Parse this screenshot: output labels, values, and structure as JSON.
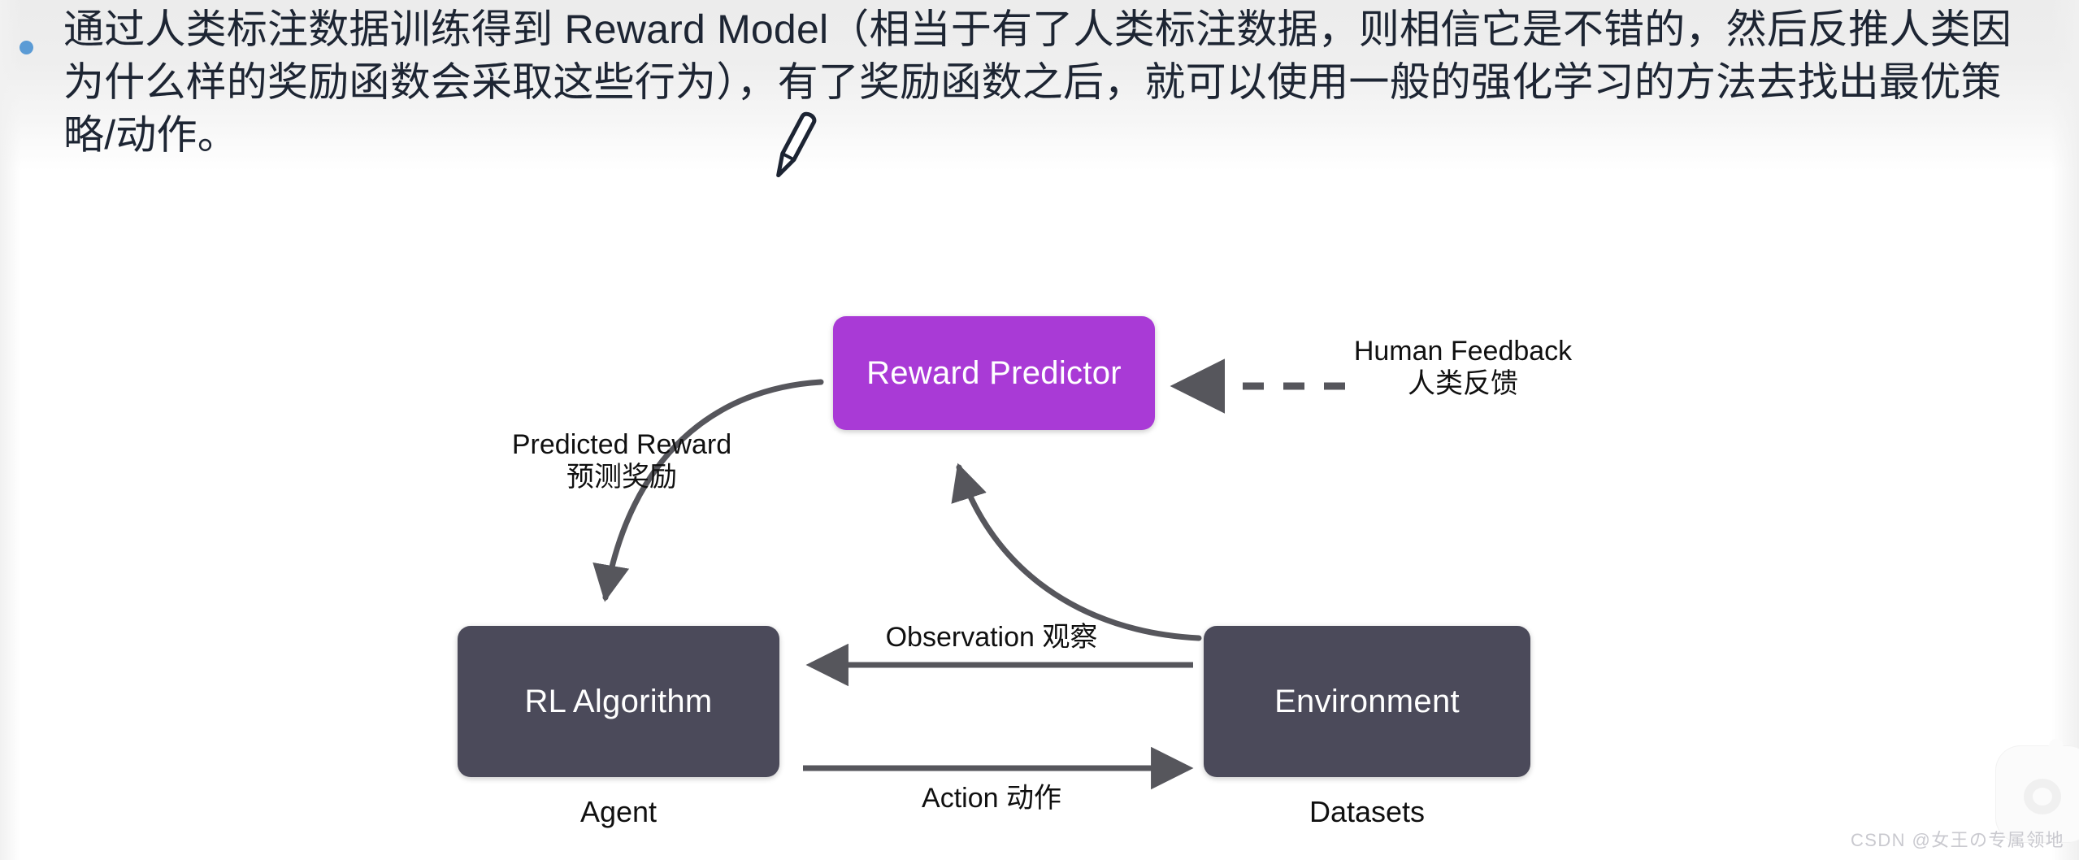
{
  "slide": {
    "bullet": {
      "marker": "bullet-dot",
      "text": "通过人类标注数据训练得到 Reward Model（相当于有了人类标注数据，则相信它是不错的，然后反推人类因为什么样的奖励函数会采取这些行为），有了奖励函数之后，就可以使用一般的强化学习的方法去找出最优策略/动作。"
    },
    "cursor_icon": "pen-cursor"
  },
  "diagram": {
    "type": "flow-diagram",
    "nodes": [
      {
        "id": "reward_predictor",
        "label": "Reward Predictor",
        "color": "#a93ad6",
        "caption": ""
      },
      {
        "id": "rl_algorithm",
        "label": "RL Algorithm",
        "color": "#4b4a5a",
        "caption": "Agent"
      },
      {
        "id": "environment",
        "label": "Environment",
        "color": "#4b4a5a",
        "caption": "Datasets"
      }
    ],
    "captions": {
      "agent": "Agent",
      "datasets": "Datasets"
    },
    "edges": [
      {
        "id": "predicted_reward",
        "from": "reward_predictor",
        "to": "rl_algorithm",
        "style": "curved-solid",
        "label_en": "Predicted Reward",
        "label_zh": "预测奖励"
      },
      {
        "id": "human_feedback",
        "from": "human",
        "to": "reward_predictor",
        "style": "dashed",
        "label_en": "Human Feedback",
        "label_zh": "人类反馈"
      },
      {
        "id": "observation",
        "from": "environment",
        "to": "rl_algorithm",
        "style": "straight-solid",
        "label_en": "Observation 观察",
        "label_zh": ""
      },
      {
        "id": "action",
        "from": "rl_algorithm",
        "to": "environment",
        "style": "straight-solid",
        "label_en": "Action 动作",
        "label_zh": ""
      },
      {
        "id": "observation_to_predictor",
        "from": "environment",
        "to": "reward_predictor",
        "style": "curved-solid",
        "label_en": "",
        "label_zh": ""
      }
    ],
    "colors": {
      "accent_purple": "#a93ad6",
      "node_dark": "#4b4a5a",
      "edge_gray": "#56565c",
      "bullet_blue": "#5b9bd5"
    }
  },
  "watermark": {
    "text": "CSDN @女王の专属领地",
    "logo": "csdn-logo"
  }
}
